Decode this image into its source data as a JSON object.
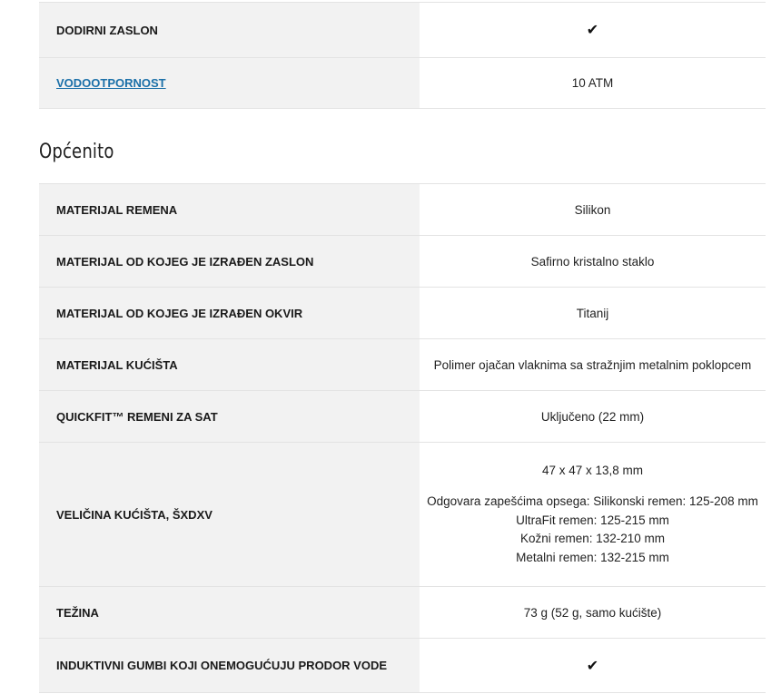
{
  "top_rows": [
    {
      "label": "DODIRNI ZASLON",
      "value_icon": "checkmark-icon"
    },
    {
      "label": "VODOOTPORNOST",
      "value": "10 ATM",
      "label_is_link": true
    }
  ],
  "section_title": "Općenito",
  "rows": [
    {
      "label": "MATERIJAL REMENA",
      "value": "Silikon"
    },
    {
      "label": "MATERIJAL OD KOJEG JE IZRAĐEN ZASLON",
      "value": "Safirno kristalno staklo"
    },
    {
      "label": "MATERIJAL OD KOJEG JE IZRAĐEN OKVIR",
      "value": "Titanij"
    },
    {
      "label": "MATERIJAL KUĆIŠTA",
      "value": "Polimer ojačan vlaknima sa stražnjim metalnim poklopcem"
    },
    {
      "label": "QUICKFIT™ REMENI ZA SAT",
      "value": "Uključeno (22 mm)"
    },
    {
      "label": "VELIČINA KUĆIŠTA, ŠXDXV",
      "value_lines": [
        "47 x 47 x 13,8 mm",
        "Odgovara zapešćima opsega: Silikonski remen: 125-208 mm",
        "UltraFit remen: 125-215 mm",
        "Kožni remen: 132-210 mm",
        "Metalni remen: 132-215 mm"
      ]
    },
    {
      "label": "TEŽINA",
      "value": "73 g (52 g, samo kućište)"
    },
    {
      "label": "INDUKTIVNI GUMBI KOJI ONEMOGUĆUJU PRODOR VODE",
      "value_icon": "checkmark-icon"
    }
  ],
  "check_glyph": "✔"
}
